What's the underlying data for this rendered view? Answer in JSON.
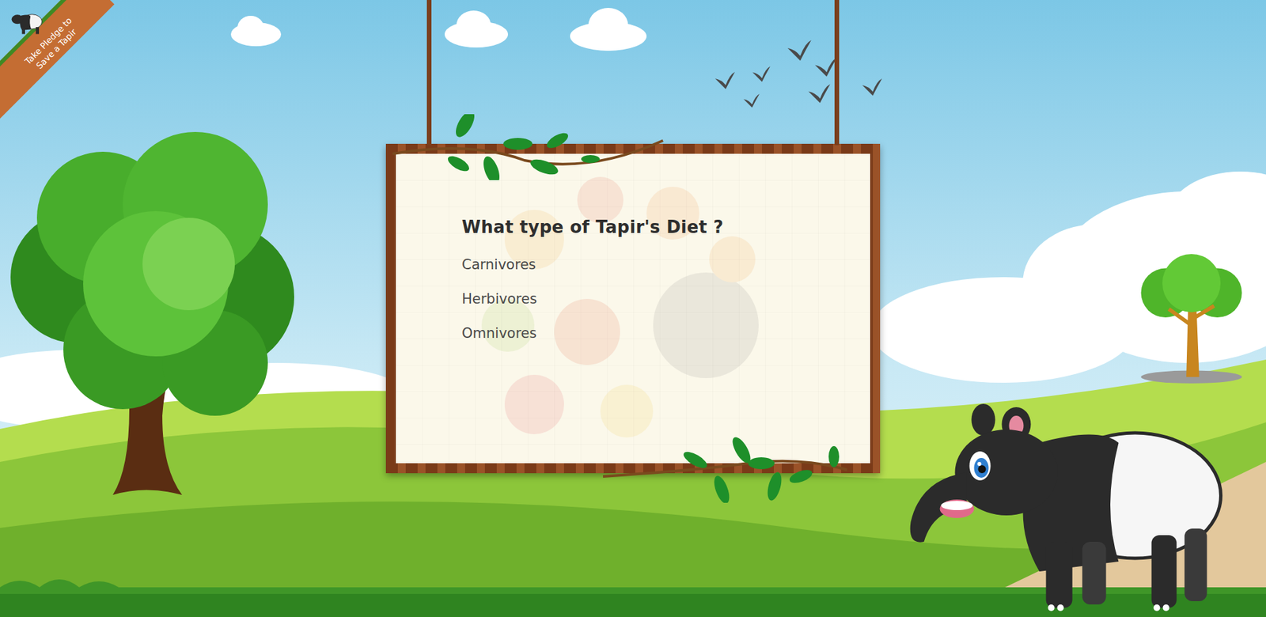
{
  "ribbon": {
    "lines": [
      "Take Pledge to",
      "Save a Tapir"
    ]
  },
  "quiz": {
    "question": "What type of Tapir's Diet ?",
    "options": [
      {
        "label": "Carnivores",
        "selected": false
      },
      {
        "label": "Herbivores",
        "selected": false
      },
      {
        "label": "Omnivores",
        "selected": false
      }
    ]
  }
}
